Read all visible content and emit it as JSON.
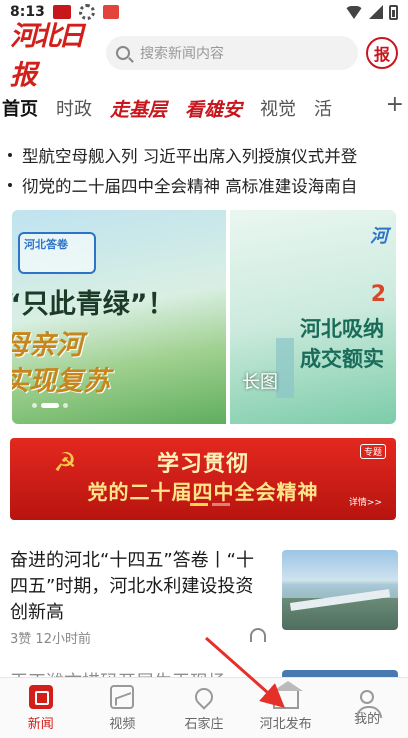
{
  "status_bar": {
    "time": "8:13"
  },
  "header": {
    "logo": "河北日报",
    "search_placeholder": "搜索新闻内容",
    "bao": "报"
  },
  "tabs": [
    {
      "label": "首页",
      "active": true
    },
    {
      "label": "时政",
      "active": false
    },
    {
      "label": "走基层",
      "active": false,
      "brand": true
    },
    {
      "label": "看雄安",
      "active": false,
      "brand": true
    },
    {
      "label": "视觉",
      "active": false
    },
    {
      "label": "活",
      "active": false
    }
  ],
  "tab_plus": "+",
  "headlines": [
    "型航空母舰入列 习近平出席入列授旗仪式并登",
    "彻党的二十届四中全会精神 高标准建设海南自"
  ],
  "carousel": {
    "slide1_chip": "河北答卷",
    "slide1_title": "“只此青绿”！",
    "slide1_river": "母亲河",
    "slide1_river2": "实现复苏",
    "slide2_chip": "河",
    "slide2_num": "2",
    "slide2_title1": "河北吸纳",
    "slide2_title2": "成交额实",
    "long_pic_label": "长图"
  },
  "banner": {
    "tag": "专题",
    "title1": "学习贯彻",
    "title2": "党的二十届四中全会精神",
    "more": "详情>>"
  },
  "article": {
    "title": "奋进的河北“十四五”答卷丨“十四五”时期，河北水利建设投资创新高",
    "likes": "3赞",
    "time": "12小时前"
  },
  "peek_text": "王正潍文措码开展生王现场",
  "bottom_nav": [
    {
      "label": "新闻",
      "icon": "news-icon",
      "active": true
    },
    {
      "label": "视频",
      "icon": "video-icon",
      "active": false
    },
    {
      "label": "石家庄",
      "icon": "location-pin-icon",
      "active": false
    },
    {
      "label": "河北发布",
      "icon": "crown-icon",
      "active": false
    },
    {
      "label": "我的",
      "icon": "user-icon",
      "active": false
    }
  ],
  "colors": {
    "brand_red": "#d21f1a",
    "annotation_red": "#e5302a"
  }
}
